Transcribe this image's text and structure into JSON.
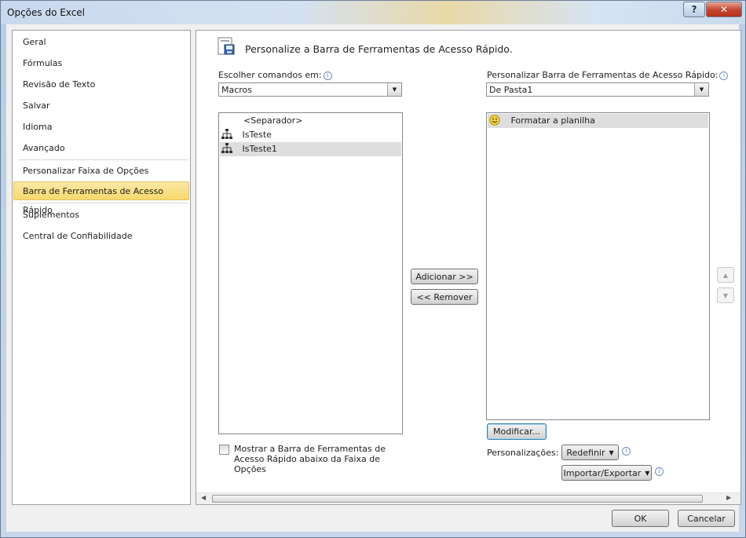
{
  "window": {
    "title": "Opções do Excel",
    "help_glyph": "?",
    "close_glyph": "✕"
  },
  "nav": {
    "items": [
      {
        "label": "Geral"
      },
      {
        "label": "Fórmulas"
      },
      {
        "label": "Revisão de Texto"
      },
      {
        "label": "Salvar"
      },
      {
        "label": "Idioma"
      },
      {
        "label": "Avançado"
      },
      {
        "label": "Personalizar Faixa de Opções"
      },
      {
        "label": "Barra de Ferramentas de Acesso Rápido",
        "selected": true
      },
      {
        "label": "Suplementos"
      },
      {
        "label": "Central de Confiabilidade"
      }
    ]
  },
  "main": {
    "header": "Personalize a Barra de Ferramentas de Acesso Rápido.",
    "choose_label": "Escolher comandos em:",
    "choose_value": "Macros",
    "customize_label": "Personalizar Barra de Ferramentas de Acesso Rápido:",
    "customize_value": "De Pasta1",
    "left_list": [
      {
        "label": "<Separador>",
        "icon": "separator"
      },
      {
        "label": "IsTeste",
        "icon": "macro-icon"
      },
      {
        "label": "IsTeste1",
        "icon": "macro-icon",
        "selected": true
      }
    ],
    "right_list": [
      {
        "label": "Formatar a planilha",
        "icon": "smiley-icon",
        "selected": true
      }
    ],
    "add_button": "Adicionar >>",
    "remove_button": "<< Remover",
    "modify_button": "Modificar...",
    "personalizations_label": "Personalizações:",
    "reset_button": "Redefinir",
    "import_export_button": "Importar/Exportar",
    "show_below_checkbox": "Mostrar a Barra de Ferramentas de Acesso Rápido abaixo da Faixa de Opções",
    "show_below_checked": false,
    "move_up_glyph": "▲",
    "move_down_glyph": "▼"
  },
  "footer": {
    "ok": "OK",
    "cancel": "Cancelar"
  },
  "colors": {
    "selected_nav": "#f7d96d",
    "selected_row": "#dedede",
    "accent": "#3c7fb1"
  }
}
